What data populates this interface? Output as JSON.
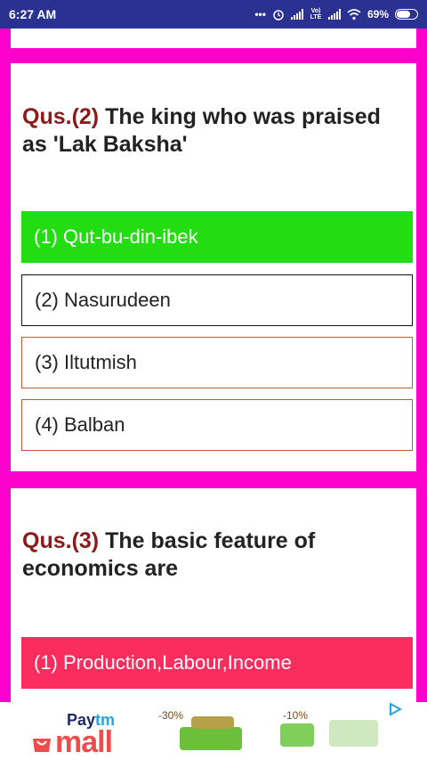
{
  "status_bar": {
    "time": "6:27 AM",
    "network_label": "Vo) LTE",
    "battery": "69%",
    "battery_fraction": 0.69
  },
  "questions": [
    {
      "number_label": "Qus.(2)",
      "text": "The king who was praised as 'Lak Baksha'",
      "options": [
        {
          "label": "(1) Qut-bu-din-ibek",
          "state": "correct"
        },
        {
          "label": "(2) Nasurudeen",
          "state": "selected"
        },
        {
          "label": "(3) Iltutmish",
          "state": "normal"
        },
        {
          "label": "(4) Balban",
          "state": "normal"
        }
      ]
    },
    {
      "number_label": "Qus.(3)",
      "text": "The basic feature of economics are",
      "options": [
        {
          "label": "(1) Production,Labour,Income",
          "state": "wrong"
        }
      ]
    }
  ],
  "ad": {
    "brand_top": "Pay",
    "brand_tm": "tm",
    "brand_bottom": "mall",
    "discount_1": "-30%",
    "discount_2": "-10%",
    "colors": {
      "mall": "#ef4d4d",
      "paytm": "#1b2b6b",
      "play": "#20a4e4"
    }
  },
  "colors": {
    "background": "#ff00cc",
    "status_bar": "#2b3190",
    "correct": "#22dd11",
    "wrong": "#fb2d5e",
    "question_number": "#8b1a1a"
  }
}
